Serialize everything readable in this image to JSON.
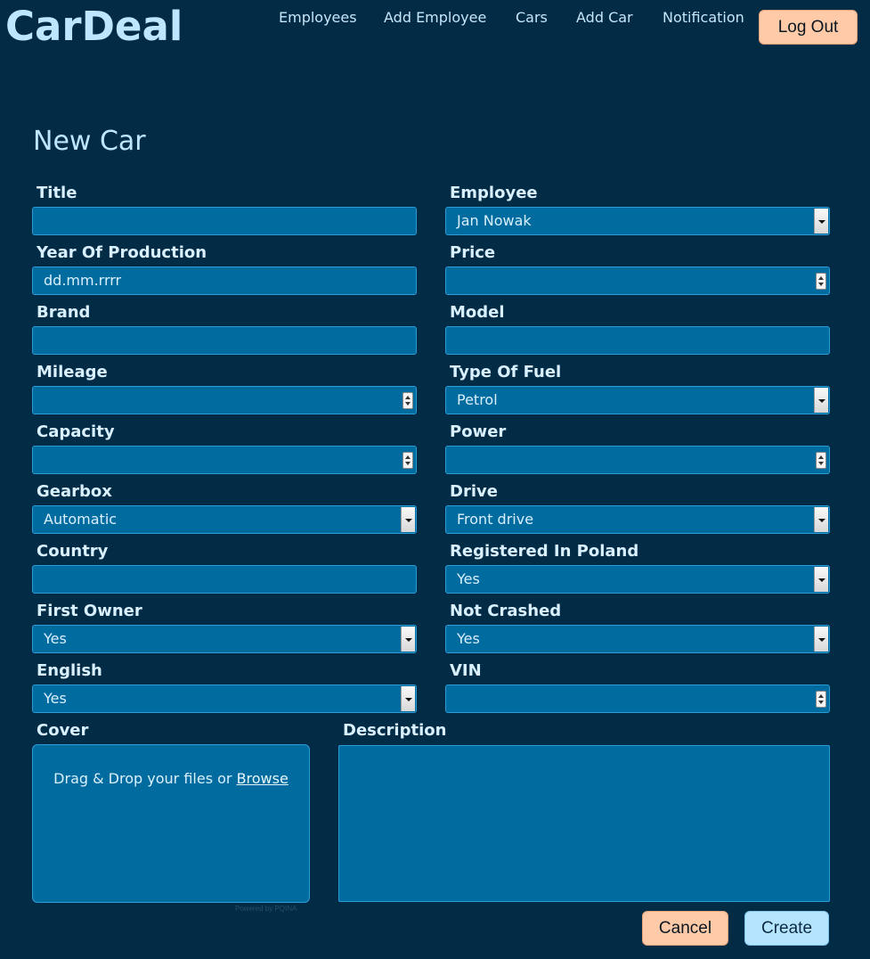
{
  "header": {
    "logo": "CarDeal",
    "nav": [
      {
        "label": "Employees"
      },
      {
        "label": "Add Employee"
      },
      {
        "label": "Cars"
      },
      {
        "label": "Add Car"
      },
      {
        "label": "Notification"
      }
    ],
    "logout_label": "Log Out"
  },
  "form": {
    "title": "New Car",
    "fields": {
      "title": {
        "label": "Title",
        "value": ""
      },
      "employee": {
        "label": "Employee",
        "value": "Jan Nowak"
      },
      "year": {
        "label": "Year Of Production",
        "value": "dd.mm.rrrr"
      },
      "price": {
        "label": "Price",
        "value": ""
      },
      "brand": {
        "label": "Brand",
        "value": ""
      },
      "model": {
        "label": "Model",
        "value": ""
      },
      "mileage": {
        "label": "Mileage",
        "value": ""
      },
      "fuel": {
        "label": "Type Of Fuel",
        "value": "Petrol"
      },
      "capacity": {
        "label": "Capacity",
        "value": ""
      },
      "power": {
        "label": "Power",
        "value": ""
      },
      "gearbox": {
        "label": "Gearbox",
        "value": "Automatic"
      },
      "drive": {
        "label": "Drive",
        "value": "Front drive"
      },
      "country": {
        "label": "Country",
        "value": ""
      },
      "registered": {
        "label": "Registered In Poland",
        "value": "Yes"
      },
      "first_owner": {
        "label": "First Owner",
        "value": "Yes"
      },
      "not_crashed": {
        "label": "Not Crashed",
        "value": "Yes"
      },
      "english": {
        "label": "English",
        "value": "Yes"
      },
      "vin": {
        "label": "VIN",
        "value": ""
      }
    },
    "cover": {
      "label": "Cover",
      "text": "Drag & Drop your files or ",
      "link": "Browse",
      "powered": "Powered by PQINA"
    },
    "description": {
      "label": "Description",
      "value": ""
    },
    "cancel_label": "Cancel",
    "create_label": "Create"
  }
}
